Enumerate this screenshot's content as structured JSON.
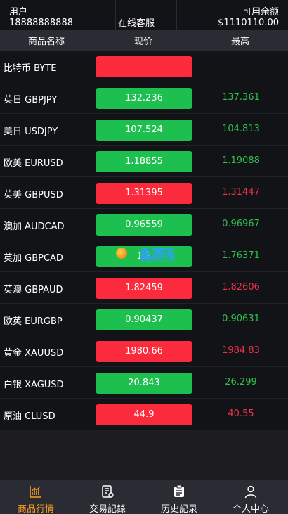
{
  "header": {
    "user_label": "用户",
    "user_phone": "18888888888",
    "service_label": "在线客服",
    "balance_label": "可用余额",
    "balance_value": "$1110110.00"
  },
  "columns": {
    "name": "商品名称",
    "price": "现价",
    "high": "最高"
  },
  "colors": {
    "up": "#1dbf4f",
    "down": "#fb2a3c",
    "active_nav": "#f6a020"
  },
  "rows": [
    {
      "name": "比特币 BYTE",
      "price": "",
      "high": "",
      "trend": "down"
    },
    {
      "name": "英日 GBPJPY",
      "price": "132.236",
      "high": "137.361",
      "trend": "up"
    },
    {
      "name": "美日 USDJPY",
      "price": "107.524",
      "high": "104.813",
      "trend": "up"
    },
    {
      "name": "欧美 EURUSD",
      "price": "1.18855",
      "high": "1.19088",
      "trend": "up"
    },
    {
      "name": "英美 GBPUSD",
      "price": "1.31395",
      "high": "1.31447",
      "trend": "down"
    },
    {
      "name": "澳加 AUDCAD",
      "price": "0.96559",
      "high": "0.96967",
      "trend": "up"
    },
    {
      "name": "英加 GBPCAD",
      "price": "1.7",
      "high": "1.76371",
      "trend": "up"
    },
    {
      "name": "英澳 GBPAUD",
      "price": "1.82459",
      "high": "1.82606",
      "trend": "down"
    },
    {
      "name": "欧英 EURGBP",
      "price": "0.90437",
      "high": "0.90631",
      "trend": "up"
    },
    {
      "name": "黄金 XAUUSD",
      "price": "1980.66",
      "high": "1984.83",
      "trend": "down"
    },
    {
      "name": "白银 XAGUSD",
      "price": "20.843",
      "high": "26.299",
      "trend": "up"
    },
    {
      "name": "原油 CLUSD",
      "price": "44.9",
      "high": "40.55",
      "trend": "down"
    }
  ],
  "watermark": {
    "text": "鱼源码",
    "sub": "yfaysoruo.com"
  },
  "nav": [
    {
      "label": "商品行情",
      "icon": "chart-icon",
      "active": true
    },
    {
      "label": "交易記錄",
      "icon": "trade-record-icon",
      "active": false
    },
    {
      "label": "历史記录",
      "icon": "history-icon",
      "active": false
    },
    {
      "label": "个人中心",
      "icon": "user-icon",
      "active": false
    }
  ]
}
